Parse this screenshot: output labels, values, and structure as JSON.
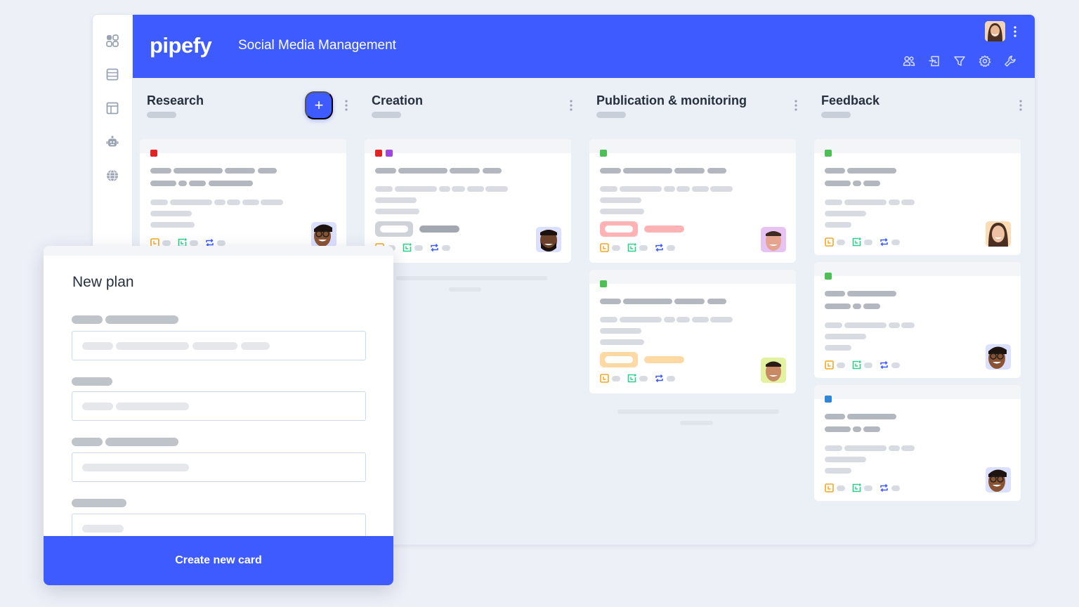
{
  "header": {
    "logo": "pipefy",
    "board_title": "Social Media Management",
    "actions": [
      "members-icon",
      "import-icon",
      "filter-icon",
      "settings-icon",
      "wrench-icon"
    ]
  },
  "sidebar": {
    "items": [
      "apps-grid-icon",
      "database-icon",
      "layout-icon",
      "automation-bot-icon",
      "globe-icon"
    ]
  },
  "phases": [
    {
      "title": "Research",
      "has_add_button": true,
      "add_label": "+",
      "cards": [
        {
          "tags": [
            "#e02424"
          ]
        }
      ]
    },
    {
      "title": "Creation",
      "cards": [
        {
          "tags": [
            "#e02424",
            "#a046e0"
          ],
          "label_color": "#cfd3d9"
        }
      ]
    },
    {
      "title": "Publication & monitoring",
      "cards": [
        {
          "tags": [
            "#4cbf55"
          ],
          "label_color": "#ffb3b5"
        },
        {
          "tags": [
            "#4cbf55"
          ],
          "label_color": "#ffd9a3"
        }
      ]
    },
    {
      "title": "Feedback",
      "cards": [
        {
          "tags": [
            "#4cbf55"
          ]
        },
        {
          "tags": [
            "#4cbf55"
          ]
        },
        {
          "tags": [
            "#2f86d8"
          ]
        }
      ]
    }
  ],
  "modal": {
    "title": "New plan",
    "submit_label": "Create new card"
  },
  "colors": {
    "brand": "#3e5bff",
    "icon_orange": "#f5a623",
    "icon_green": "#2ecf8a",
    "icon_blue": "#3e5bff"
  }
}
